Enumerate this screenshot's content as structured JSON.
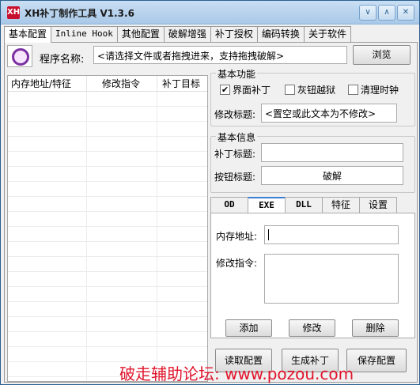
{
  "window": {
    "title": "XH补丁制作工具 V1.3.6",
    "app_icon_glyph": "XH",
    "controls": [
      "chevron-down-icon",
      "chevron-up-icon",
      "close-icon"
    ]
  },
  "main_tabs": [
    "基本配置",
    "Inline Hook",
    "其他配置",
    "破解增强",
    "补丁授权",
    "编码转换",
    "关于软件"
  ],
  "program": {
    "label": "程序名称:",
    "input_value": "<请选择文件或者拖拽进来，支持拖拽破解>",
    "browse_label": "浏览"
  },
  "patch_list": {
    "columns": [
      "内存地址/特征",
      "修改指令",
      "补丁目标"
    ],
    "rows": []
  },
  "basic_functions": {
    "title": "基本功能",
    "checkboxes": [
      {
        "label": "界面补丁",
        "checked": true
      },
      {
        "label": "灰钮越狱",
        "checked": false
      },
      {
        "label": "清理时钟",
        "checked": false
      }
    ],
    "modify_title_label": "修改标题:",
    "modify_title_value": "<置空或此文本为不修改>"
  },
  "basic_info": {
    "title": "基本信息",
    "patch_title_label": "补丁标题:",
    "patch_title_value": "",
    "button_title_label": "按钮标题:",
    "button_title_value": "破解"
  },
  "sub_tabs": [
    "OD",
    "EXE",
    "DLL",
    "特征",
    "设置"
  ],
  "sub_tab_active": "EXE",
  "exe_panel": {
    "address_label": "内存地址:",
    "address_value": "",
    "instruction_label": "修改指令:",
    "instruction_value": "",
    "add_label": "添加",
    "modify_label": "修改",
    "delete_label": "删除"
  },
  "footer": {
    "read_config": "读取配置",
    "generate_patch": "生成补丁",
    "save_config": "保存配置"
  },
  "watermark": "破走辅助论坛: www.pozou.com",
  "colors": {
    "active_tab_accent": "#3b7fd4",
    "watermark": "#e0142b",
    "titlebar": "#b7d3ee"
  }
}
